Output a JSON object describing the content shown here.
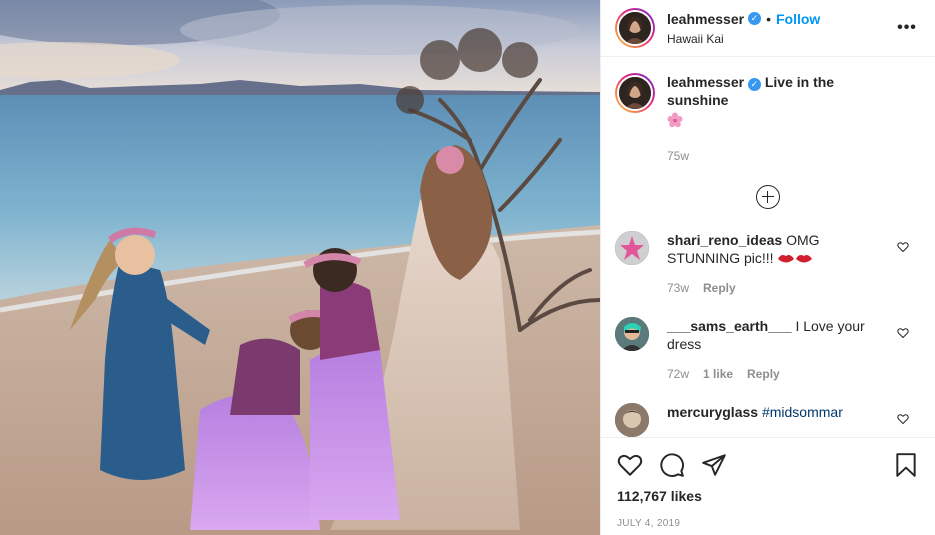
{
  "header": {
    "username": "leahmesser",
    "separator": "•",
    "follow_label": "Follow",
    "location": "Hawaii Kai",
    "more_label": "•••"
  },
  "caption": {
    "username": "leahmesser",
    "text": "Live in the sunshine",
    "emoji": "flower",
    "time": "75w"
  },
  "comments": [
    {
      "username": "shari_reno_ideas",
      "text": "OMG STUNNING pic!!!",
      "emoji": "lips lips",
      "time": "73w",
      "likes": "",
      "reply": "Reply"
    },
    {
      "username": "___sams_earth___",
      "text": "I Love your dress",
      "time": "72w",
      "likes": "1 like",
      "reply": "Reply"
    },
    {
      "username": "mercuryglass",
      "text": "#midsommar",
      "time": "",
      "likes": "",
      "reply": ""
    }
  ],
  "actions": {
    "like_icon": "heart-icon",
    "comment_icon": "comment-icon",
    "share_icon": "paper-plane-icon",
    "save_icon": "bookmark-icon",
    "likes_count": "112,767 likes",
    "date": "JULY 4, 2019"
  },
  "colors": {
    "link_blue": "#0095f6",
    "verified_blue": "#3897f0",
    "muted": "#8e8e8e",
    "text": "#262626"
  }
}
